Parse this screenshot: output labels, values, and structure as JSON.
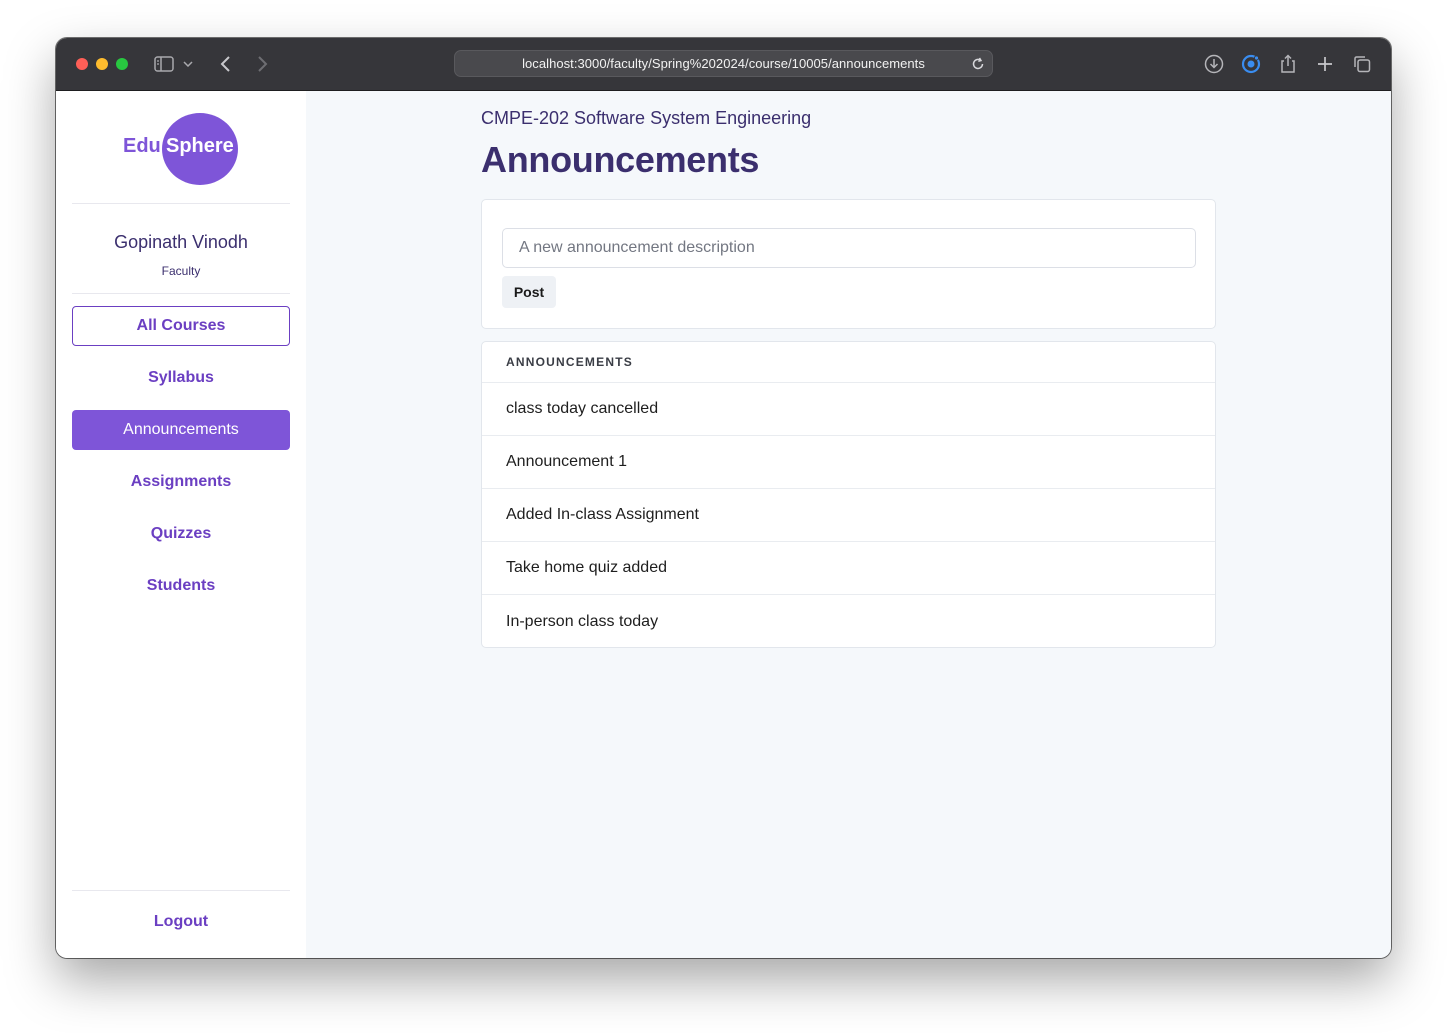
{
  "browser": {
    "url": "localhost:3000/faculty/Spring%202024/course/10005/announcements"
  },
  "sidebar": {
    "logo": {
      "left": "Edu",
      "right": "Sphere"
    },
    "user": {
      "name": "Gopinath Vinodh",
      "role": "Faculty"
    },
    "nav": [
      {
        "label": "All Courses",
        "style": "outlined"
      },
      {
        "label": "Syllabus"
      },
      {
        "label": "Announcements",
        "active": true
      },
      {
        "label": "Assignments"
      },
      {
        "label": "Quizzes"
      },
      {
        "label": "Students"
      }
    ],
    "logout_label": "Logout"
  },
  "main": {
    "course_title": "CMPE-202 Software System Engineering",
    "page_title": "Announcements",
    "new_announcement": {
      "placeholder": "A new announcement description",
      "value": "",
      "post_label": "Post"
    },
    "list": {
      "header": "ANNOUNCEMENTS",
      "items": [
        "class today cancelled",
        "Announcement 1",
        "Added In-class Assignment",
        "Take home quiz added",
        "In-person class today"
      ]
    }
  },
  "colors": {
    "accent": "#7e55d8",
    "accent_text": "#6b3fc2",
    "heading": "#3b2f6e",
    "background": "#f5f8fb"
  }
}
